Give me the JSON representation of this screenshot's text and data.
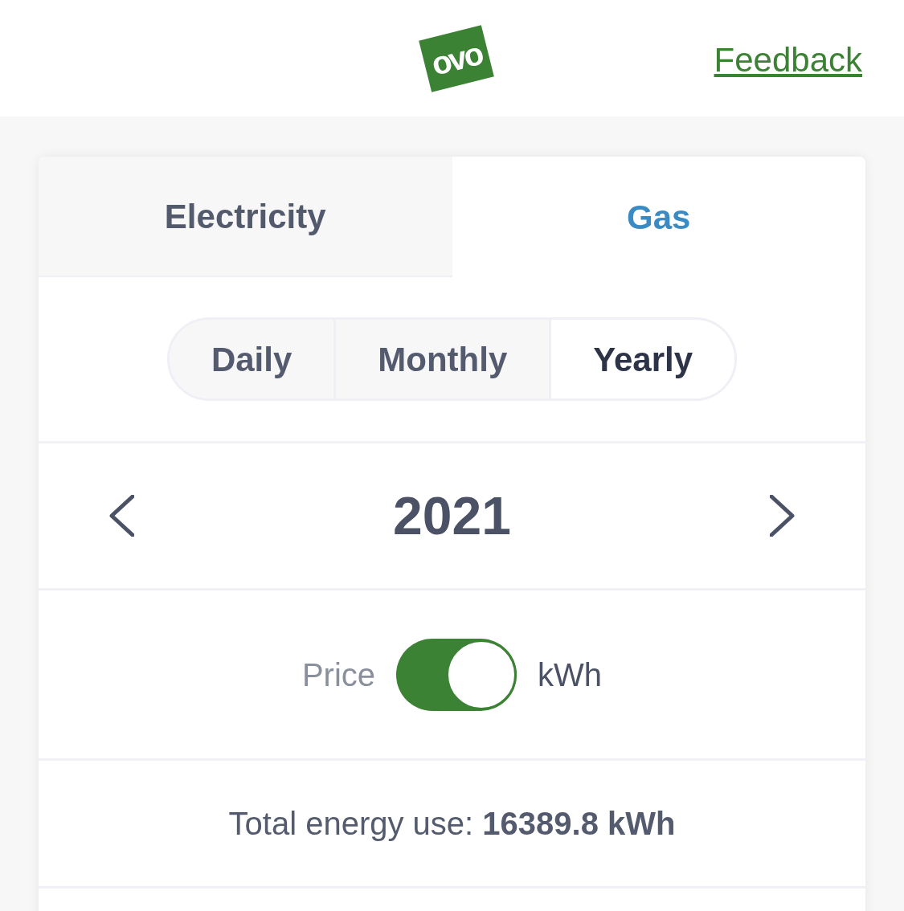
{
  "header": {
    "logo_text": "ovo",
    "feedback_link": "Feedback"
  },
  "fuel_tabs": [
    {
      "label": "Electricity",
      "selected": false
    },
    {
      "label": "Gas",
      "selected": true
    }
  ],
  "periods": [
    {
      "label": "Daily",
      "selected": false
    },
    {
      "label": "Monthly",
      "selected": false
    },
    {
      "label": "Yearly",
      "selected": true
    }
  ],
  "period_nav": {
    "label": "2021"
  },
  "unit_toggle": {
    "left_label": "Price",
    "right_label": "kWh",
    "on": true
  },
  "summary": {
    "text": "Total energy use: **16389.8 kWh**"
  }
}
